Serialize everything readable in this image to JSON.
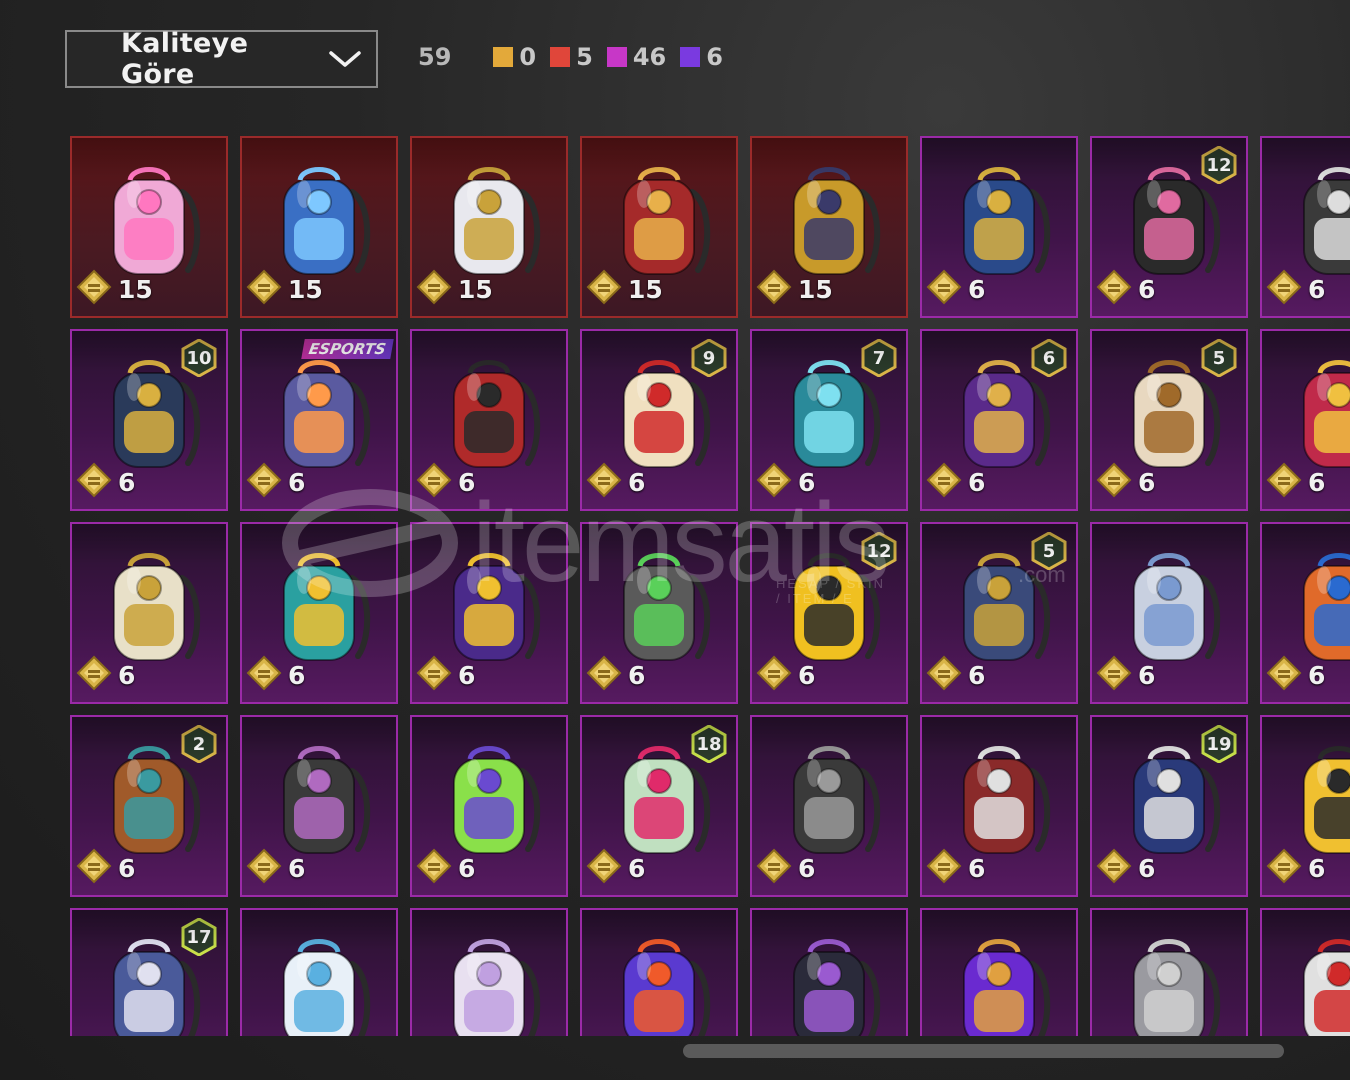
{
  "sort": {
    "label": "Kaliteye Göre"
  },
  "counts": {
    "total": "59",
    "qualities": [
      {
        "color": "#e3a93a",
        "value": "0"
      },
      {
        "color": "#e0463a",
        "value": "5"
      },
      {
        "color": "#c737c7",
        "value": "46"
      },
      {
        "color": "#7a3ae0",
        "value": "6"
      }
    ]
  },
  "watermark": {
    "text": "itemsatis",
    "sub": "HESAP / SKIN / ITEM / E",
    "com": ".com"
  },
  "items": [
    {
      "rarity": "red",
      "price": "15",
      "badge": "",
      "icon": "pink-heart-backpack-icon",
      "main": "#f0a9d6",
      "accent": "#ff77c0"
    },
    {
      "rarity": "red",
      "price": "15",
      "badge": "",
      "icon": "blue-ice-backpack-icon",
      "main": "#3a6fc4",
      "accent": "#7ec8ff"
    },
    {
      "rarity": "red",
      "price": "15",
      "badge": "",
      "icon": "white-wing-backpack-icon",
      "main": "#e8e8ee",
      "accent": "#c9a23a"
    },
    {
      "rarity": "red",
      "price": "15",
      "badge": "",
      "icon": "crimson-demon-backpack-icon",
      "main": "#a52a2a",
      "accent": "#e8b04a"
    },
    {
      "rarity": "red",
      "price": "15",
      "badge": "",
      "icon": "pharaoh-gold-backpack-icon",
      "main": "#c89a2a",
      "accent": "#3a3a6a"
    },
    {
      "rarity": "purple",
      "price": "6",
      "badge": "",
      "icon": "pharaoh-blue-backpack-icon",
      "main": "#2a4a8a",
      "accent": "#d9b040"
    },
    {
      "rarity": "purple",
      "price": "6",
      "badge": "12",
      "icon": "black-pink-bear-backpack-icon",
      "main": "#2a2a2a",
      "accent": "#e06aa0"
    },
    {
      "rarity": "purple",
      "price": "6",
      "badge": "",
      "icon": "spiked-monster-backpack-icon",
      "main": "#3a3a3a",
      "accent": "#dddddd"
    },
    {
      "rarity": "purple",
      "price": "6",
      "badge": "10",
      "icon": "navy-gold-backpack-icon",
      "main": "#2a3a5a",
      "accent": "#d9b040"
    },
    {
      "rarity": "purple",
      "price": "6",
      "badge": "esports",
      "icon": "esports-backpack-icon",
      "main": "#5a5aa0",
      "accent": "#ff9a4a"
    },
    {
      "rarity": "purple",
      "price": "6",
      "badge": "",
      "icon": "red-black-backpack-icon",
      "main": "#b02a2a",
      "accent": "#2a2a2a"
    },
    {
      "rarity": "purple",
      "price": "6",
      "badge": "9",
      "icon": "clown-backpack-icon",
      "main": "#f0e0c0",
      "accent": "#d02a2a"
    },
    {
      "rarity": "purple",
      "price": "6",
      "badge": "7",
      "icon": "teal-astronaut-backpack-icon",
      "main": "#2a8a9a",
      "accent": "#7ee0f0"
    },
    {
      "rarity": "purple",
      "price": "6",
      "badge": "6",
      "icon": "royal-gem-backpack-icon",
      "main": "#5a2a8a",
      "accent": "#e0b04a"
    },
    {
      "rarity": "purple",
      "price": "6",
      "badge": "5",
      "icon": "gold-flower-backpack-icon",
      "main": "#e8d8c0",
      "accent": "#a06a2a"
    },
    {
      "rarity": "purple",
      "price": "6",
      "badge": "",
      "icon": "heart-backpack-icon",
      "main": "#c02a4a",
      "accent": "#f0c040"
    },
    {
      "rarity": "purple",
      "price": "6",
      "badge": "",
      "icon": "ivory-gold-backpack-icon",
      "main": "#e8e0c8",
      "accent": "#c9a23a"
    },
    {
      "rarity": "purple",
      "price": "6",
      "badge": "",
      "icon": "teal-yellow-robot-backpack-icon",
      "main": "#2aa0a0",
      "accent": "#f0c030"
    },
    {
      "rarity": "purple",
      "price": "6",
      "badge": "",
      "icon": "purple-monster-backpack-icon",
      "main": "#4a2a8a",
      "accent": "#f0c030"
    },
    {
      "rarity": "purple",
      "price": "6",
      "badge": "",
      "icon": "arcade-backpack-icon",
      "main": "#5a5a5a",
      "accent": "#5ad05a"
    },
    {
      "rarity": "purple",
      "price": "6",
      "badge": "12",
      "icon": "yellow-box-backpack-icon",
      "main": "#f0c020",
      "accent": "#2a2a2a"
    },
    {
      "rarity": "purple",
      "price": "6",
      "badge": "5",
      "icon": "blue-compass-backpack-icon",
      "main": "#3a4a7a",
      "accent": "#c9a23a"
    },
    {
      "rarity": "purple",
      "price": "6",
      "badge": "",
      "icon": "shark-backpack-icon",
      "main": "#c8d0e0",
      "accent": "#7a9ad0"
    },
    {
      "rarity": "purple",
      "price": "6",
      "badge": "",
      "icon": "orange-blue-backpack-icon",
      "main": "#e06a2a",
      "accent": "#2a6ad0"
    },
    {
      "rarity": "purple",
      "price": "6",
      "badge": "2",
      "icon": "brown-leather-backpack-icon",
      "main": "#a05a2a",
      "accent": "#3a9aa0"
    },
    {
      "rarity": "purple",
      "price": "6",
      "badge": "",
      "icon": "dark-fringe-backpack-icon",
      "main": "#3a3a3a",
      "accent": "#b06ac0"
    },
    {
      "rarity": "purple",
      "price": "6",
      "badge": "",
      "icon": "green-monster-backpack-icon",
      "main": "#8ae04a",
      "accent": "#6a4ad0"
    },
    {
      "rarity": "purple",
      "price": "6",
      "badge": "18",
      "icon": "neon-green-backpack-icon",
      "main": "#c0e0c0",
      "accent": "#e02a6a"
    },
    {
      "rarity": "purple",
      "price": "6",
      "badge": "",
      "icon": "black-tactical-backpack-icon",
      "main": "#3a3a3a",
      "accent": "#9a9a9a"
    },
    {
      "rarity": "purple",
      "price": "6",
      "badge": "",
      "icon": "red-armor-backpack-icon",
      "main": "#8a2a2a",
      "accent": "#e0e0e0"
    },
    {
      "rarity": "purple",
      "price": "6",
      "badge": "19",
      "icon": "navy-scarab-backpack-icon",
      "main": "#2a3a7a",
      "accent": "#e0e0e0"
    },
    {
      "rarity": "purple",
      "price": "6",
      "badge": "",
      "icon": "yellow-black-backpack-icon",
      "main": "#f0c030",
      "accent": "#2a2a2a"
    },
    {
      "rarity": "purple",
      "price": "",
      "badge": "17",
      "icon": "silver-wing-backpack-icon",
      "main": "#4a5a9a",
      "accent": "#e0e0f0"
    },
    {
      "rarity": "purple",
      "price": "",
      "badge": "",
      "icon": "snowman-backpack-icon",
      "main": "#e8f0f8",
      "accent": "#5ab0e0"
    },
    {
      "rarity": "purple",
      "price": "",
      "badge": "",
      "icon": "unicorn-backpack-icon",
      "main": "#e8e0f0",
      "accent": "#c0a0e0"
    },
    {
      "rarity": "purple",
      "price": "",
      "badge": "",
      "icon": "clown-purple-backpack-icon",
      "main": "#5a3ad0",
      "accent": "#f05a2a"
    },
    {
      "rarity": "purple",
      "price": "",
      "badge": "",
      "icon": "black-purple-backpack-icon",
      "main": "#2a2a3a",
      "accent": "#9a5ad0"
    },
    {
      "rarity": "purple",
      "price": "",
      "badge": "",
      "icon": "purple-wing-backpack-icon",
      "main": "#6a2ad0",
      "accent": "#e0a040"
    },
    {
      "rarity": "purple",
      "price": "",
      "badge": "",
      "icon": "grey-wing-backpack-icon",
      "main": "#9a9aa0",
      "accent": "#d0d0d0"
    },
    {
      "rarity": "purple",
      "price": "",
      "badge": "",
      "icon": "red-white-backpack-icon",
      "main": "#e0e0e0",
      "accent": "#d02a2a"
    }
  ]
}
